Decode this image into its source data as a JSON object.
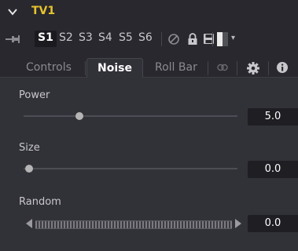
{
  "header": {
    "tool_name": "TV1"
  },
  "toolbar": {
    "slots": [
      "S1",
      "S2",
      "S3",
      "S4",
      "S5",
      "S6"
    ],
    "active_slot": "S1"
  },
  "tabs": [
    {
      "label": "Controls",
      "active": false
    },
    {
      "label": "Noise",
      "active": true
    },
    {
      "label": "Roll Bar",
      "active": false
    }
  ],
  "controls": {
    "power": {
      "label": "Power",
      "value": "5.0",
      "fraction": 0.26
    },
    "size": {
      "label": "Size",
      "value": "0.0",
      "fraction": 0.0
    },
    "random": {
      "label": "Random",
      "value": "0.0"
    }
  },
  "colors": {
    "accent_title": "#e8c32d",
    "panel_bg": "#313138",
    "header_bg": "#28282e"
  },
  "icons": [
    "collapse-arrow-icon",
    "pin-icon",
    "reset-icon",
    "lock-icon",
    "save-icon",
    "color-swatch-icon",
    "dropdown-arrow-icon",
    "link-icon",
    "gear-icon",
    "info-icon"
  ]
}
